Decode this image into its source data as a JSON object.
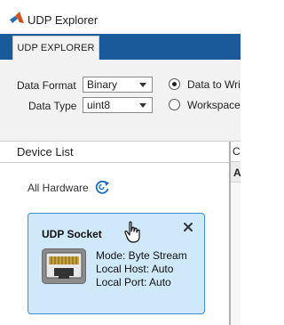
{
  "app": {
    "title": "UDP Explorer",
    "accent": "#1b5a9a"
  },
  "tabs": [
    {
      "label": "UDP EXPLORER",
      "active": true
    }
  ],
  "ribbon": {
    "data_format": {
      "label": "Data Format",
      "value": "Binary"
    },
    "data_type": {
      "label": "Data Type",
      "value": "uint8"
    },
    "destination": [
      {
        "label": "Data to Wri",
        "checked": true
      },
      {
        "label": "Workspace",
        "checked": false
      }
    ]
  },
  "device_list": {
    "title": "Device List",
    "all_hardware_label": "All Hardware",
    "refresh_icon": "refresh-icon"
  },
  "device_card": {
    "title": "UDP Socket",
    "icon": "ethernet-port-icon",
    "mode": "Mode: Byte Stream",
    "local_host": "Local Host: Auto",
    "local_port": "Local Port: Auto",
    "selected_color": "#cfe8fa",
    "border_color": "#3a8fd6"
  },
  "right_pane": {
    "header_1": "C",
    "header_2": "A"
  }
}
